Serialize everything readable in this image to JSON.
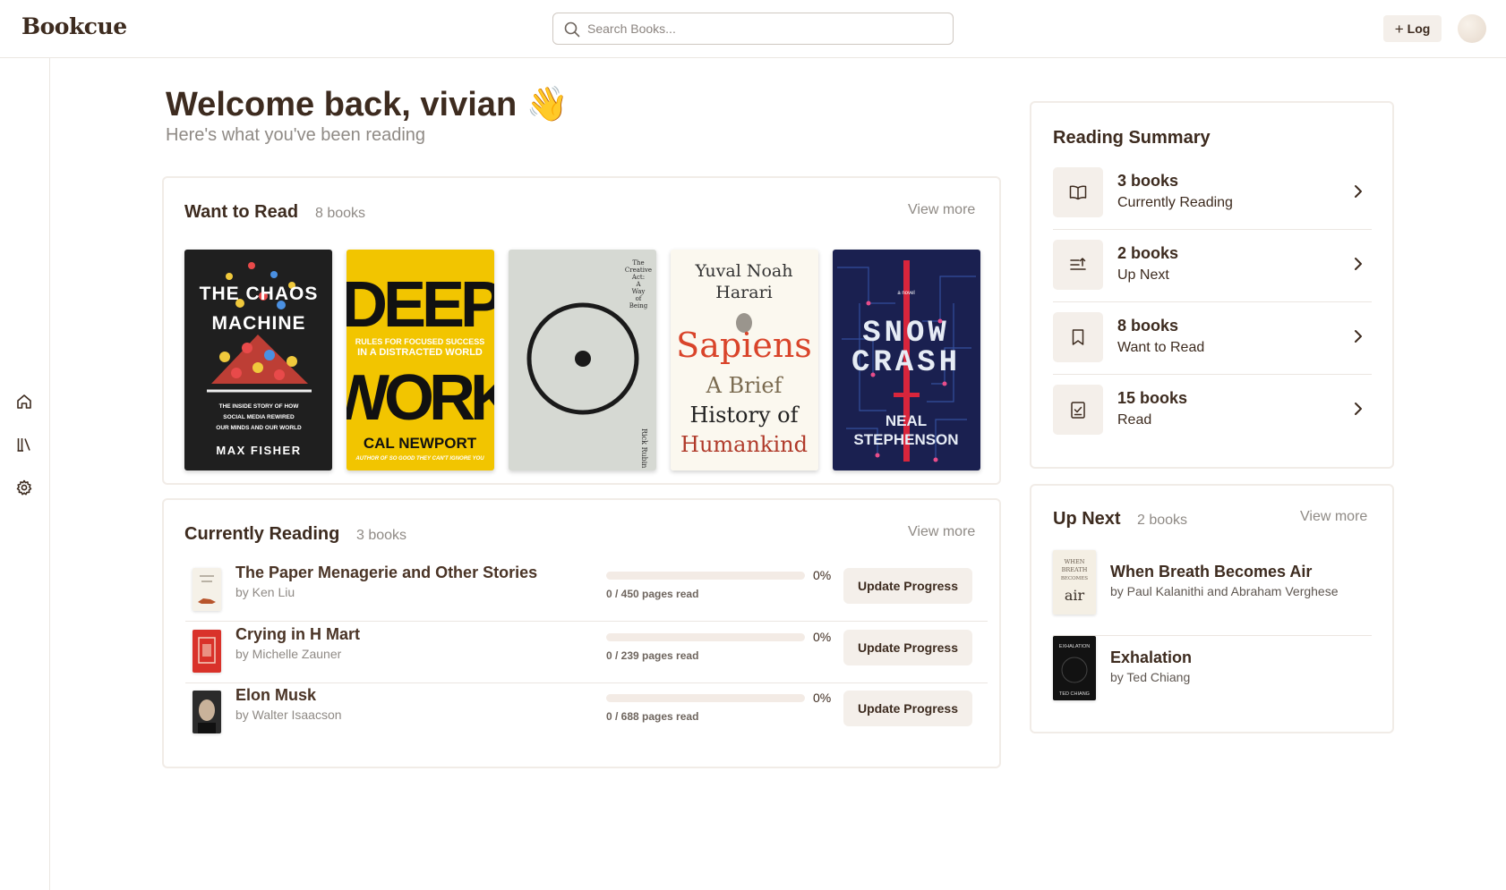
{
  "app": {
    "logo": "Bookcue"
  },
  "header": {
    "search_placeholder": "Search Books...",
    "log_label": "Log",
    "log_icon": "plus-icon"
  },
  "sidebar": {
    "icons": [
      "home-icon",
      "library-icon",
      "settings-icon"
    ]
  },
  "welcome": {
    "title": "Welcome back, vivian 👋",
    "subtitle": "Here's what you've been reading"
  },
  "want_to_read": {
    "title": "Want to Read",
    "count": "8 books",
    "view_more": "View more",
    "covers": {
      "chaos_machine": {
        "title_line1": "THE CHAOS",
        "title_line2": "MACHINE",
        "tag1": "THE INSIDE STORY OF HOW",
        "tag2": "SOCIAL MEDIA REWIRED",
        "tag3": "OUR MINDS AND OUR WORLD",
        "author": "MAX FISHER"
      },
      "deep_work": {
        "title_line1": "DEEP",
        "title_line2": "WORK",
        "tag1": "RULES FOR FOCUSED SUCCESS",
        "tag2": "IN A DISTRACTED WORLD",
        "author": "CAL NEWPORT",
        "blurb": "AUTHOR OF SO GOOD THEY CAN'T IGNORE YOU"
      },
      "creative_act": {
        "spine1": "The",
        "spine2": "Creative",
        "spine3": "Act:",
        "spine4": "A",
        "spine5": "Way",
        "spine6": "of",
        "spine7": "Being",
        "author": "Rick Rubin"
      },
      "sapiens": {
        "author1": "Yuval Noah",
        "author2": "Harari",
        "title": "Sapiens",
        "sub1": "A Brief",
        "sub2": "History of",
        "sub3": "Humankind"
      },
      "snow_crash": {
        "tag": "a novel",
        "title1": "SNOW",
        "title2": "CRASH",
        "author1": "NEAL",
        "author2": "STEPHENSON"
      }
    }
  },
  "currently_reading": {
    "title": "Currently Reading",
    "count": "3 books",
    "view_more": "View more",
    "button_label": "Update Progress",
    "books": [
      {
        "title": "The Paper Menagerie and Other Stories",
        "author": "by Ken Liu",
        "percent": "0%",
        "progress": 0,
        "pages": "0 / 450 pages read"
      },
      {
        "title": "Crying in H Mart",
        "author": "by Michelle Zauner",
        "percent": "0%",
        "progress": 0,
        "pages": "0 / 239 pages read"
      },
      {
        "title": "Elon Musk",
        "author": "by Walter Isaacson",
        "percent": "0%",
        "progress": 0,
        "pages": "0 / 688 pages read"
      }
    ]
  },
  "reading_summary": {
    "title": "Reading Summary",
    "items": [
      {
        "count": "3 books",
        "label": "Currently Reading",
        "icon": "open-book-icon"
      },
      {
        "count": "2 books",
        "label": "Up Next",
        "icon": "queue-list-icon"
      },
      {
        "count": "8 books",
        "label": "Want to Read",
        "icon": "bookmark-icon"
      },
      {
        "count": "15 books",
        "label": "Read",
        "icon": "checked-clipboard-icon"
      }
    ]
  },
  "up_next": {
    "title": "Up Next",
    "count": "2 books",
    "view_more": "View more",
    "books": [
      {
        "title": "When Breath Becomes Air",
        "author": "by Paul Kalanithi and Abraham Verghese",
        "cover_line1": "WHEN",
        "cover_line2": "BREATH",
        "cover_line3": "BECOMES",
        "cover_line4": "air"
      },
      {
        "title": "Exhalation",
        "author": "by Ted Chiang",
        "cover_title": "EXHALATION",
        "cover_author": "TED CHIANG"
      }
    ]
  },
  "colors": {
    "brand_text": "#3d2b1f",
    "muted_text": "#8f8a85",
    "button_bg": "#f4efea",
    "border": "#f1ece7",
    "progress_track": "#f3ebe5",
    "deep_work_yellow": "#f2c500",
    "sapiens_red": "#d9442a"
  }
}
